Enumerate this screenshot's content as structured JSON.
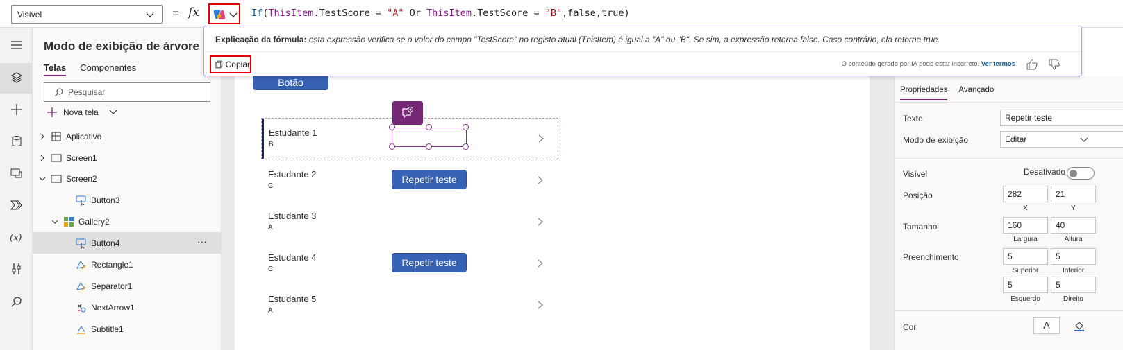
{
  "formula_bar": {
    "property": "Visível",
    "equals": "=",
    "fx": "fx",
    "formula_tokens": [
      {
        "t": "If",
        "c": "tk-fn"
      },
      {
        "t": "(",
        "c": "tk-op"
      },
      {
        "t": "ThisItem",
        "c": "tk-id"
      },
      {
        "t": ".TestScore = ",
        "c": "tk-op"
      },
      {
        "t": "\"A\"",
        "c": "tk-str"
      },
      {
        "t": " Or ",
        "c": "tk-kw"
      },
      {
        "t": "ThisItem",
        "c": "tk-id"
      },
      {
        "t": ".TestScore = ",
        "c": "tk-op"
      },
      {
        "t": "\"B\"",
        "c": "tk-str"
      },
      {
        "t": ",false,true)",
        "c": "tk-op"
      }
    ]
  },
  "explanation": {
    "heading": "Explicação da fórmula:",
    "body": "esta expressão verifica se o valor do campo \"TestScore\" no registo atual (ThisItem) é igual a \"A\" ou \"B\". Se sim, a expressão retorna false. Caso contrário, ela retorna true.",
    "copy_label": "Copiar",
    "disclaimer": "O conteúdo gerado por IA pode estar incorreto.",
    "terms_link": "Ver termos"
  },
  "tree": {
    "title": "Modo de exibição de árvore",
    "tabs": [
      "Telas",
      "Componentes"
    ],
    "search_placeholder": "Pesquisar",
    "new_screen": "Nova tela",
    "items": [
      {
        "label": "Aplicativo",
        "indent": 0,
        "expander": "right",
        "icon": "app-grid"
      },
      {
        "label": "Screen1",
        "indent": 0,
        "expander": "right",
        "icon": "screen"
      },
      {
        "label": "Screen2",
        "indent": 0,
        "expander": "down",
        "icon": "screen"
      },
      {
        "label": "Button3",
        "indent": 2,
        "expander": "",
        "icon": "button"
      },
      {
        "label": "Gallery2",
        "indent": 1,
        "expander": "down",
        "icon": "gallery"
      },
      {
        "label": "Button4",
        "indent": 2,
        "expander": "",
        "icon": "button",
        "selected": true
      },
      {
        "label": "Rectangle1",
        "indent": 2,
        "expander": "",
        "icon": "shape"
      },
      {
        "label": "Separator1",
        "indent": 2,
        "expander": "",
        "icon": "shape"
      },
      {
        "label": "NextArrow1",
        "indent": 2,
        "expander": "",
        "icon": "icon-shape"
      },
      {
        "label": "Subtitle1",
        "indent": 2,
        "expander": "",
        "icon": "label"
      }
    ]
  },
  "canvas": {
    "top_button": "Botão",
    "rows": [
      {
        "name": "Estudante 1",
        "grade": "B"
      },
      {
        "name": "Estudante 2",
        "grade": "C"
      },
      {
        "name": "Estudante 3",
        "grade": "A"
      },
      {
        "name": "Estudante 4",
        "grade": "C"
      },
      {
        "name": "Estudante 5",
        "grade": "A"
      }
    ],
    "retry_label": "Repetir teste"
  },
  "properties": {
    "tabs": [
      "Propriedades",
      "Avançado"
    ],
    "texto_label": "Texto",
    "texto_value": "Repetir teste",
    "modo_label": "Modo de exibição",
    "modo_value": "Editar",
    "visivel_label": "Visível",
    "visivel_value": "Desativado",
    "posicao_label": "Posição",
    "pos_x": "282",
    "pos_y": "21",
    "x_label": "X",
    "y_label": "Y",
    "tamanho_label": "Tamanho",
    "largura": "160",
    "altura": "40",
    "largura_label": "Largura",
    "altura_label": "Altura",
    "preench_label": "Preenchimento",
    "sup": "5",
    "inf": "5",
    "esq": "5",
    "dir": "5",
    "sup_label": "Superior",
    "inf_label": "Inferior",
    "esq_label": "Esquerdo",
    "dir_label": "Direito",
    "cor_label": "Cor",
    "cor_value": "A"
  }
}
